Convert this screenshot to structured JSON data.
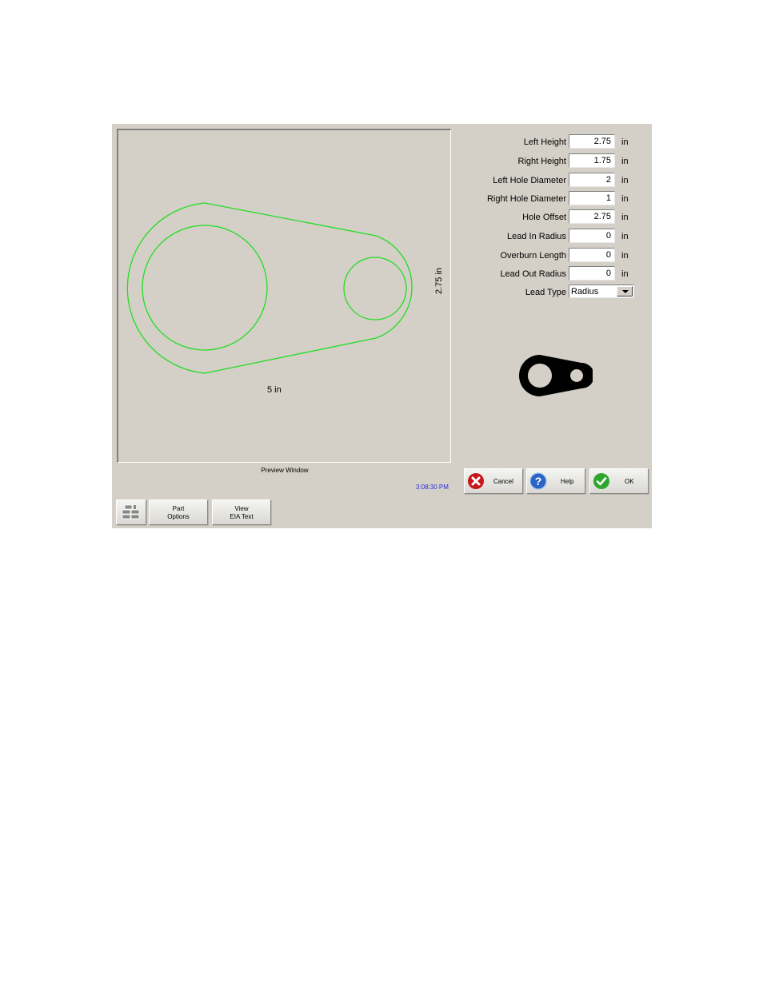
{
  "preview": {
    "caption": "Preview Window",
    "width_dim": "5 in",
    "height_dim": "2.75 in",
    "stroke_color": "#22dd22"
  },
  "clock": "3:08:30 PM",
  "fields": [
    {
      "label": "Left Height",
      "value": "2.75",
      "unit": "in"
    },
    {
      "label": "Right Height",
      "value": "1.75",
      "unit": "in"
    },
    {
      "label": "Left Hole Diameter",
      "value": "2",
      "unit": "in"
    },
    {
      "label": "Right Hole Diameter",
      "value": "1",
      "unit": "in"
    },
    {
      "label": "Hole Offset",
      "value": "2.75",
      "unit": "in"
    },
    {
      "label": "Lead In Radius",
      "value": "0",
      "unit": "in"
    },
    {
      "label": "Overburn Length",
      "value": "0",
      "unit": "in"
    },
    {
      "label": "Lead Out Radius",
      "value": "0",
      "unit": "in"
    }
  ],
  "lead_type": {
    "label": "Lead Type",
    "value": "Radius"
  },
  "buttons": {
    "cancel": "Cancel",
    "help": "Help",
    "ok": "OK",
    "part_options_line1": "Part",
    "part_options_line2": "Options",
    "view_eia_line1": "View",
    "view_eia_line2": "EIA Text"
  },
  "icons": {
    "cancel": "red-x-circle-icon",
    "help": "blue-question-circle-icon",
    "ok": "green-check-circle-icon",
    "shape_library": "shape-library-icon"
  }
}
